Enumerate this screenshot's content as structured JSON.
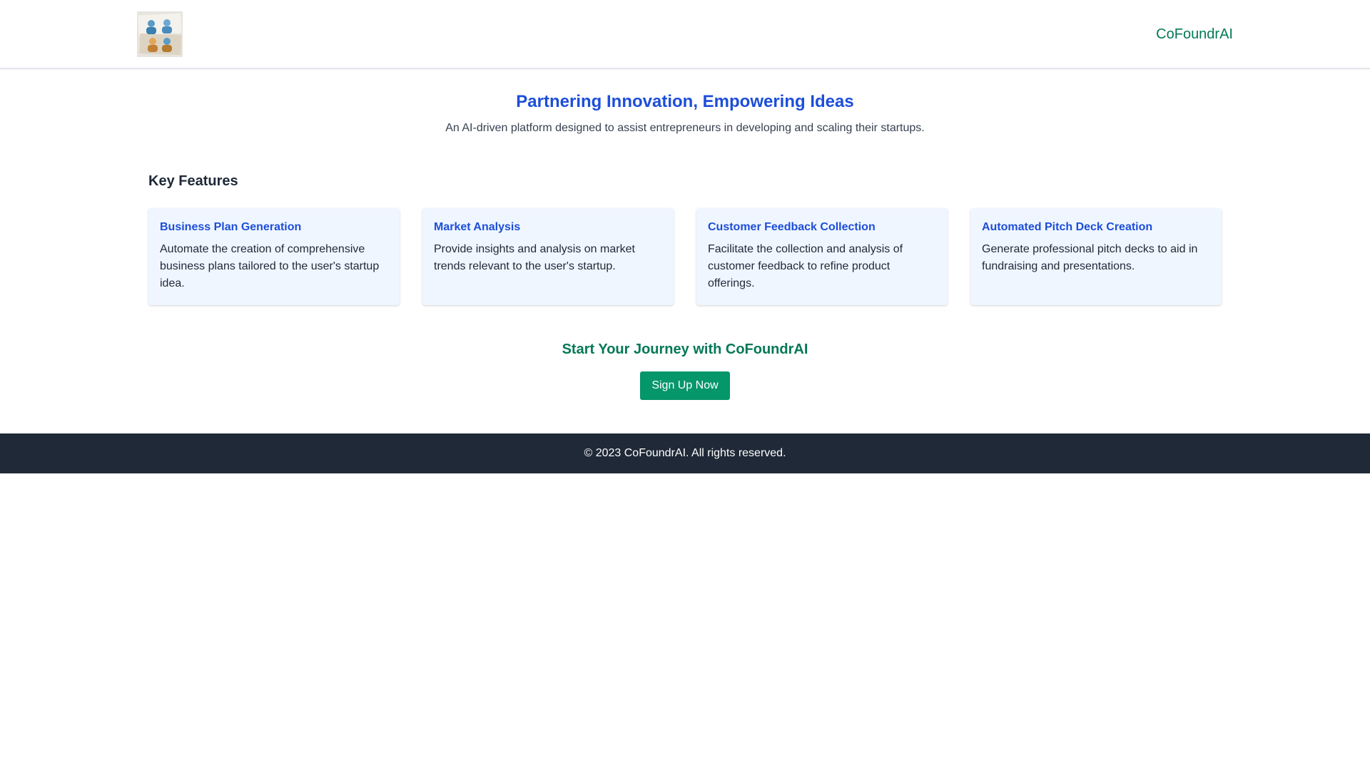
{
  "colors": {
    "primary_blue": "#1d4ed8",
    "accent_green": "#047857",
    "button_green": "#059669",
    "card_bg": "#eff6ff",
    "footer_bg": "#1f2937",
    "text_dark": "#1f2937",
    "text_muted": "#374151"
  },
  "header": {
    "logo_icon": "cofounder-team-logo-icon",
    "brand": "CoFoundrAI"
  },
  "hero": {
    "title": "Partnering Innovation, Empowering Ideas",
    "subtitle": "An AI-driven platform designed to assist entrepreneurs in developing and scaling their startups."
  },
  "features": {
    "heading": "Key Features",
    "items": [
      {
        "title": "Business Plan Generation",
        "description": "Automate the creation of comprehensive business plans tailored to the user's startup idea."
      },
      {
        "title": "Market Analysis",
        "description": "Provide insights and analysis on market trends relevant to the user's startup."
      },
      {
        "title": "Customer Feedback Collection",
        "description": "Facilitate the collection and analysis of customer feedback to refine product offerings."
      },
      {
        "title": "Automated Pitch Deck Creation",
        "description": "Generate professional pitch decks to aid in fundraising and presentations."
      }
    ]
  },
  "cta": {
    "title": "Start Your Journey with CoFoundrAI",
    "button_label": "Sign Up Now"
  },
  "footer": {
    "text": "© 2023 CoFoundrAI. All rights reserved."
  }
}
